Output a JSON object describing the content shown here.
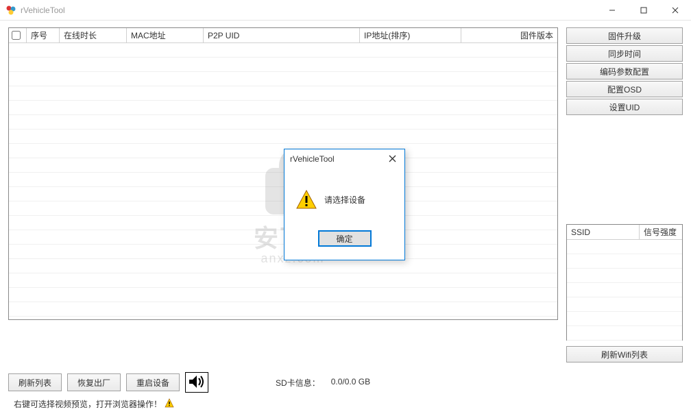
{
  "window": {
    "title": "rVehicleTool"
  },
  "table": {
    "headers": {
      "seq": "序号",
      "online": "在线时长",
      "mac": "MAC地址",
      "p2p": "P2P UID",
      "ip": "IP地址(排序)",
      "fw": "固件版本"
    }
  },
  "side_buttons": {
    "fw_upgrade": "固件升级",
    "sync_time": "同步时间",
    "encode_cfg": "编码参数配置",
    "osd_cfg": "配置OSD",
    "set_uid": "设置UID"
  },
  "wifi": {
    "ssid": "SSID",
    "signal": "信号强度",
    "refresh": "刷新Wifi列表"
  },
  "bottom": {
    "refresh_list": "刷新列表",
    "factory_reset": "恢复出厂",
    "reboot": "重启设备",
    "sd_label": "SD卡信息：",
    "sd_value": "0.0/0.0 GB"
  },
  "hint": "右键可选择视频预览，打开浏览器操作！",
  "dialog": {
    "title": "rVehicleTool",
    "message": "请选择设备",
    "ok": "确定"
  },
  "watermark": {
    "line1": "安下载",
    "line2": "anxz.com"
  }
}
